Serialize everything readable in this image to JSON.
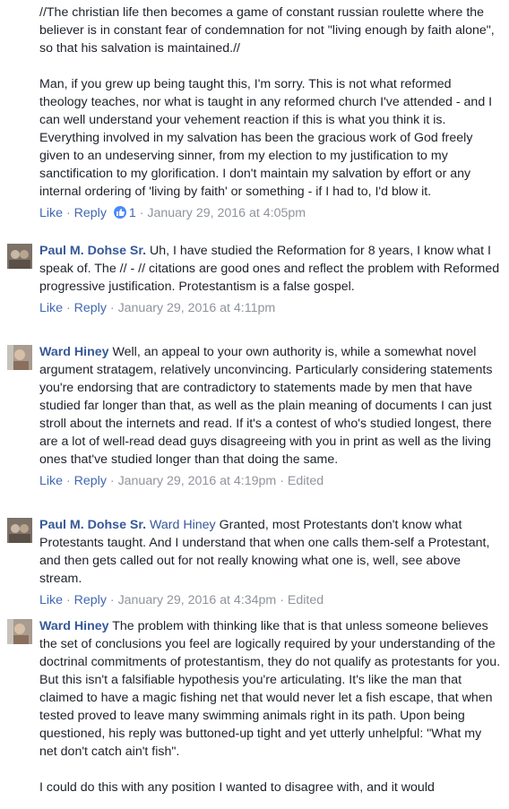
{
  "top_comment": {
    "quote": "//The christian life then becomes a game of constant russian roulette where the believer is in constant fear of condemnation for not \"living enough by faith alone\", so that his salvation is maintained.//",
    "reply": "Man, if you grew up being taught this, I'm sorry. This is not what reformed theology teaches, nor what is taught in any reformed church I've attended - and I can well understand your vehement reaction if this is what you think it is. Everything involved in my salvation has been the gracious work of God freely given to an undeserving sinner, from my election to my justification to my sanctification to my glorification. I don't maintain my salvation by effort or any internal ordering of 'living by faith' or something - if I had to, I'd blow it.",
    "like_label": "Like",
    "reply_label": "Reply",
    "reaction_count": "1",
    "timestamp": "January 29, 2016 at 4:05pm"
  },
  "comments": [
    {
      "author": "Paul M. Dohse Sr.",
      "mention": "",
      "text": "Uh, I have studied the Reformation for 8 years, I know what I speak of. The // - // citations are good ones and reflect the problem with Reformed progressive justification. Protestantism is a false gospel.",
      "like_label": "Like",
      "reply_label": "Reply",
      "timestamp": "January 29, 2016 at 4:11pm",
      "edited": ""
    },
    {
      "author": "Ward Hiney",
      "mention": "",
      "text": "Well, an appeal to your own authority is, while a somewhat novel argument stratagem, relatively unconvincing. Particularly considering statements you're endorsing that are contradictory to statements made by men that have studied far longer than that, as well as the plain meaning of documents I can just stroll about the internets and read. If it's a contest of who's studied longest, there are a lot of well-read dead guys disagreeing with you in print as well as the living ones that've studied longer than that doing the same.",
      "like_label": "Like",
      "reply_label": "Reply",
      "timestamp": "January 29, 2016 at 4:19pm",
      "edited": "Edited"
    },
    {
      "author": "Paul M. Dohse Sr.",
      "mention": "Ward Hiney",
      "text": "Granted, most Protestants don't know what Protestants taught. And I understand that when one calls them-self a Protestant, and then gets called out for not really knowing what one is, well, see above stream.",
      "like_label": "Like",
      "reply_label": "Reply",
      "timestamp": "January 29, 2016 at 4:34pm",
      "edited": "Edited"
    },
    {
      "author": "Ward Hiney",
      "mention": "",
      "text": "The problem with thinking like that is that unless someone believes the set of conclusions you feel are logically required by your understanding of the doctrinal commitments of protestantism, they do not qualify as protestants for you. But this isn't a falsifiable hypothesis you're articulating. It's like the man that claimed to have a magic fishing net that would never let a fish escape, that when tested proved to leave many swimming animals right in its path. Upon being questioned, his reply was buttoned-up tight and yet utterly unhelpful: \"What my net don't catch ain't fish\".",
      "text2": "I could do this with any position I wanted to disagree with, and it would"
    }
  ]
}
